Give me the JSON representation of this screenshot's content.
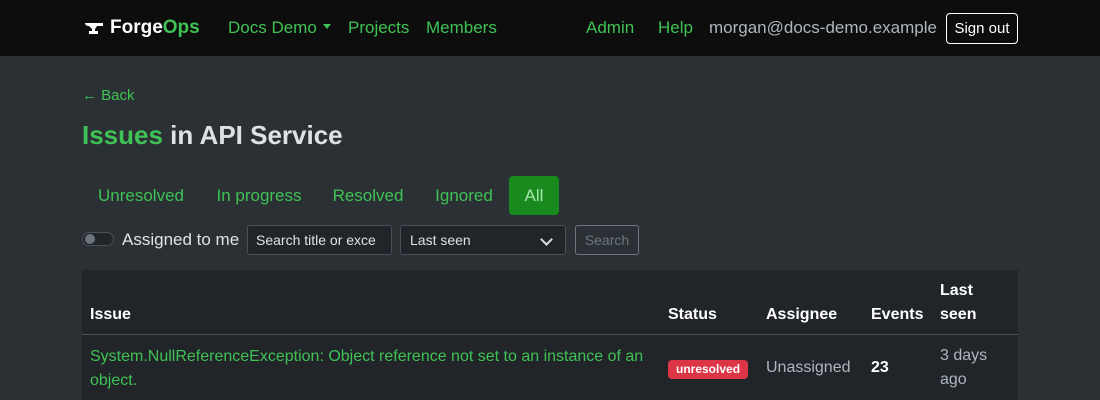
{
  "navbar": {
    "brand_prefix": "Forge",
    "brand_suffix": "Ops",
    "brand_icon": "anvil-icon",
    "org_menu": "Docs Demo",
    "projects": "Projects",
    "members": "Members",
    "admin": "Admin",
    "help": "Help",
    "user_email": "morgan@docs-demo.example",
    "sign_out": "Sign out"
  },
  "back": {
    "label": "← Back"
  },
  "title": {
    "accent": "Issues",
    "rest": " in API Service"
  },
  "tabs": [
    {
      "label": "Unresolved",
      "active": false
    },
    {
      "label": "In progress",
      "active": false
    },
    {
      "label": "Resolved",
      "active": false
    },
    {
      "label": "Ignored",
      "active": false
    },
    {
      "label": "All",
      "active": true
    }
  ],
  "filters": {
    "assigned_label": "Assigned to me",
    "assigned_on": false,
    "search_placeholder": "Search title or exce",
    "sort_selected": "Last seen",
    "search_button": "Search"
  },
  "table": {
    "headers": {
      "issue": "Issue",
      "status": "Status",
      "assignee": "Assignee",
      "events": "Events",
      "last_seen": "Last seen"
    },
    "rows": [
      {
        "title": "System.NullReferenceException: Object reference not set to an instance of an object.",
        "status": "unresolved",
        "assignee": "Unassigned",
        "events": "23",
        "last_seen": "3 days ago"
      }
    ]
  },
  "colors": {
    "accent": "#3fc254",
    "active_tab": "#198a1d",
    "badge_unresolved": "#dc3545",
    "navbar_bg": "#0d0d0d",
    "page_bg": "#2b3035"
  }
}
